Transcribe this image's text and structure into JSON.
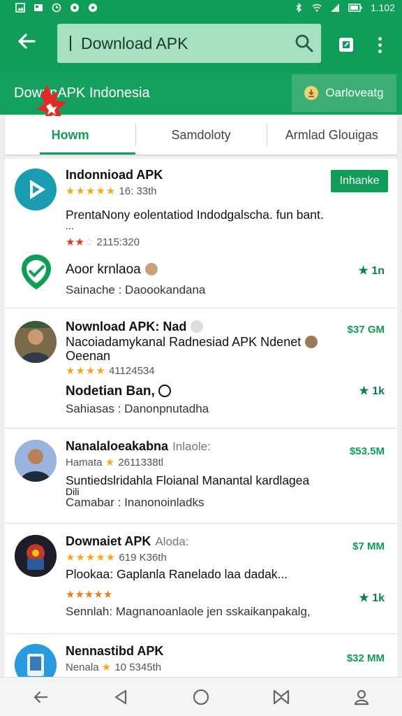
{
  "status_bar": {
    "time": "1.102"
  },
  "search": {
    "value": "Download APK"
  },
  "banner": {
    "title": "DownnAPK Indonesia",
    "download_chip": "Oarloveatg"
  },
  "tabs": [
    {
      "label": "Howm",
      "active": true
    },
    {
      "label": "Samdoloty",
      "active": false
    },
    {
      "label": "Armlad Glouigas",
      "active": false
    }
  ],
  "items": [
    {
      "title": "Indonnioad APK",
      "meta": "16: 33th",
      "install_label": "Inhanke",
      "description": "PrentaNony eolentatiod Indodgalscha. fun bant.",
      "description2": "...",
      "meta2": "2115:320",
      "second_title": "Aoor krnlaoa",
      "second_sub": "Sainache : Daoookandana",
      "second_rating": "1n"
    },
    {
      "title": "Nownload APK: Nad",
      "line2": "Nacoiadamykanal Radnesiad APK Ndenet",
      "line3": "Oeenan",
      "meta": "41124534",
      "size": "$37 GM",
      "second_title": "Nodetian Ban,",
      "second_sub": "Sahiasas : Danonpnutadha",
      "second_rating": "1k"
    },
    {
      "title": "Nanalaloeakabna",
      "title_tag": "Inlaole:",
      "meta_prefix": "Hamata",
      "meta": "2611338tl",
      "size": "$53.5M",
      "description": "Suntiedslridahla Floianal Manantal kardlagea",
      "description2": "Dili",
      "second_sub": "Camabar : Inanonoinladks"
    },
    {
      "title": "Downaiet APK",
      "title_tag": "Aloda:",
      "meta": "619 K36th",
      "size": "$7 MM",
      "description": "Plookaa: Gaplanla Ranelado laa dadak...",
      "second_sub": "Sennlah: Magnanoanlaole jen sskaikanpakalg,",
      "second_rating": "1k"
    },
    {
      "title": "Nennastibd APK",
      "meta_prefix": "Nenala",
      "meta": "10 5345th",
      "size": "$32 MM"
    }
  ]
}
